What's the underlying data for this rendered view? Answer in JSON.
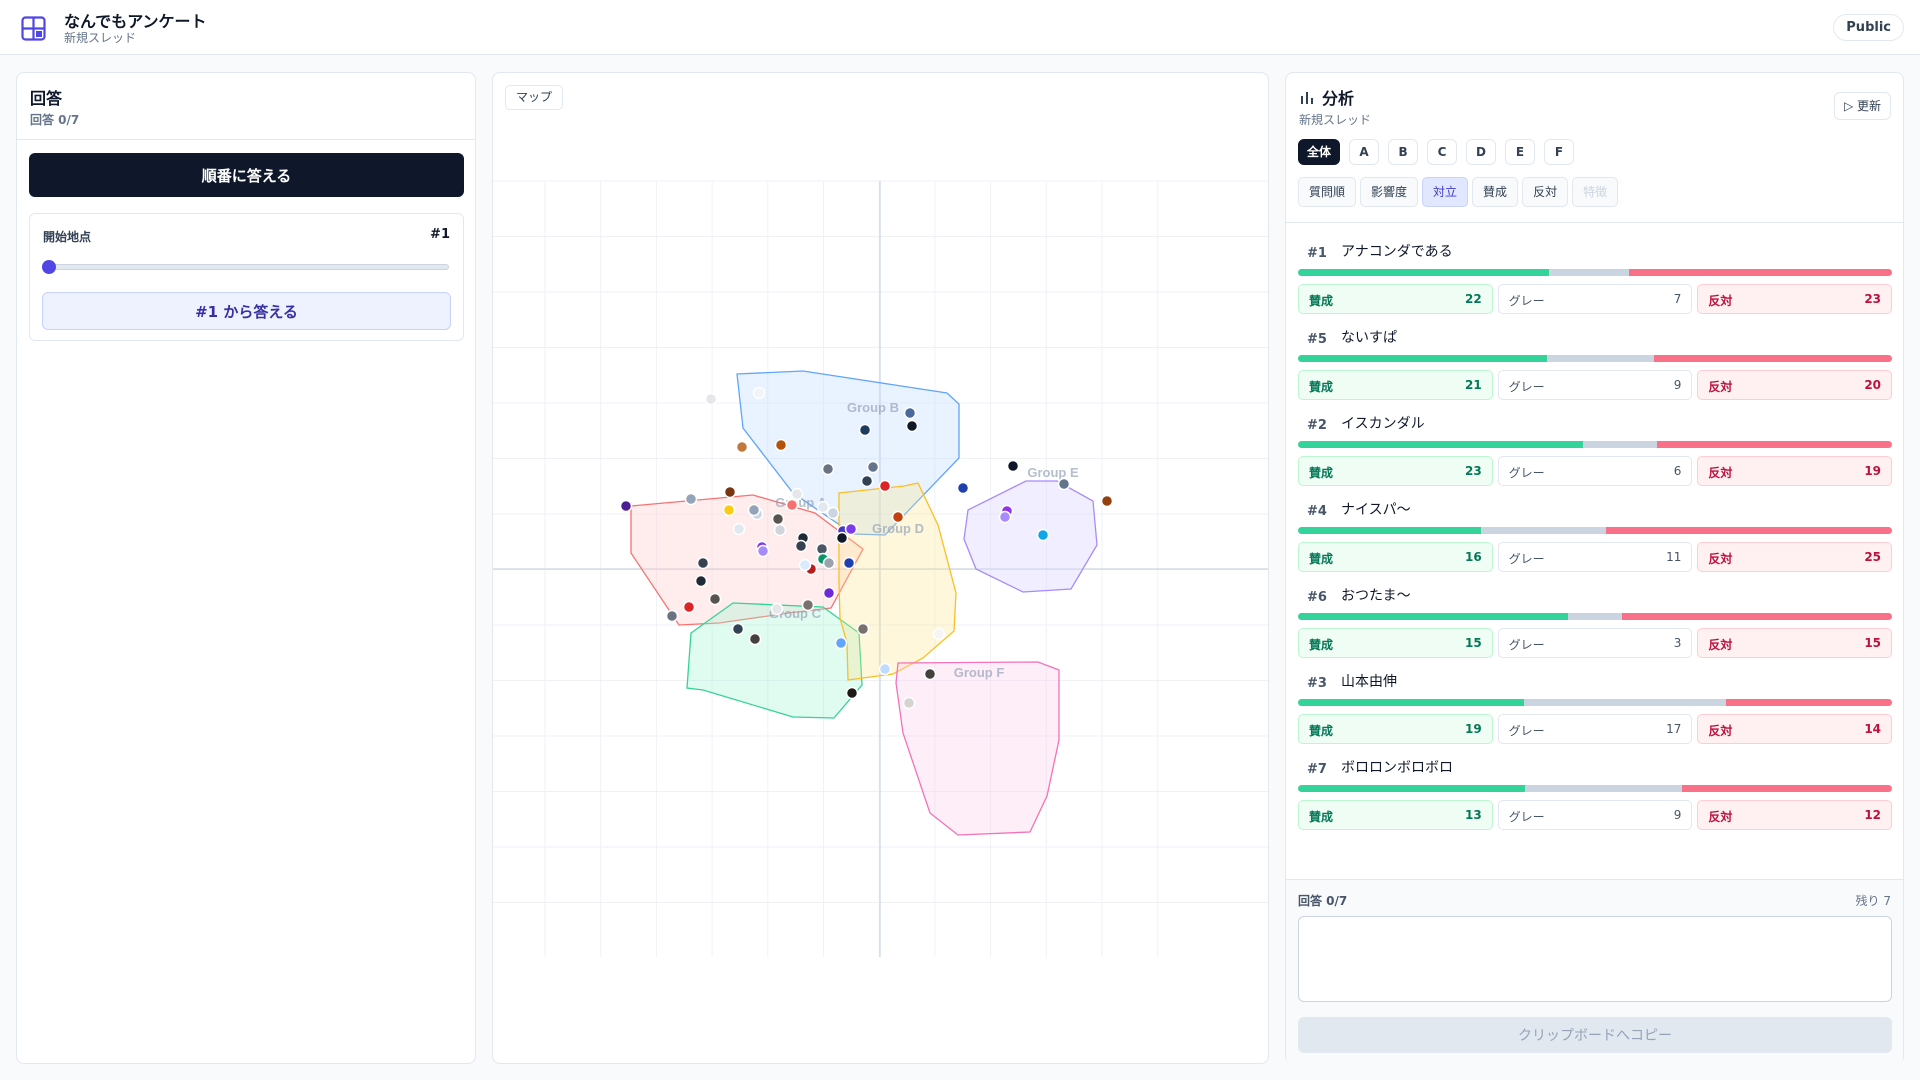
{
  "header": {
    "app_title": "なんでもアンケート",
    "subtitle": "新規スレッド",
    "badge": "Public"
  },
  "left": {
    "title": "回答",
    "progress": "回答 0/7",
    "answer_in_order": "順番に答える",
    "start_label": "開始地点",
    "start_value": "#1",
    "slider_value_fraction": 0,
    "answer_from": "#1 から答える"
  },
  "map": {
    "tab_label": "マップ",
    "groups": [
      {
        "name": "Group A",
        "color": "#f87171"
      },
      {
        "name": "Group B",
        "color": "#60a5fa"
      },
      {
        "name": "Group C",
        "color": "#34d399"
      },
      {
        "name": "Group D",
        "color": "#fbbf24"
      },
      {
        "name": "Group E",
        "color": "#a78bfa"
      },
      {
        "name": "Group F",
        "color": "#f472b6"
      }
    ]
  },
  "analysis": {
    "title": "分析",
    "subtitle": "新規スレッド",
    "refresh": "▷ 更新",
    "group_tabs": [
      "全体",
      "A",
      "B",
      "C",
      "D",
      "E",
      "F"
    ],
    "active_group": "全体",
    "sort_tabs": [
      "質問順",
      "影響度",
      "対立",
      "賛成",
      "反対",
      "特徴"
    ],
    "active_sort": "対立",
    "disabled_sort": "特徴",
    "labels": {
      "agree": "賛成",
      "gray": "グレー",
      "disagree": "反対"
    },
    "questions": [
      {
        "num": "#1",
        "text": "アナコンダである",
        "agree": 22,
        "gray": 7,
        "disagree": 23
      },
      {
        "num": "#5",
        "text": "ないすぱ",
        "agree": 21,
        "gray": 9,
        "disagree": 20
      },
      {
        "num": "#2",
        "text": "イスカンダル",
        "agree": 23,
        "gray": 6,
        "disagree": 19
      },
      {
        "num": "#4",
        "text": "ナイスパ〜",
        "agree": 16,
        "gray": 11,
        "disagree": 25
      },
      {
        "num": "#6",
        "text": "おつたま〜",
        "agree": 15,
        "gray": 3,
        "disagree": 15
      },
      {
        "num": "#3",
        "text": "山本由伸",
        "agree": 19,
        "gray": 17,
        "disagree": 14
      },
      {
        "num": "#7",
        "text": "ボロロンボロボロ",
        "agree": 13,
        "gray": 9,
        "disagree": 12
      }
    ],
    "answer_progress": "回答 0/7",
    "remaining": "残り 7",
    "copy_button": "クリップボードへコピー"
  },
  "colors": {
    "primary": "#0f172a",
    "accent": "#4f46e5",
    "agree": "#34d399",
    "gray": "#cbd5e1",
    "disagree": "#f87189"
  }
}
